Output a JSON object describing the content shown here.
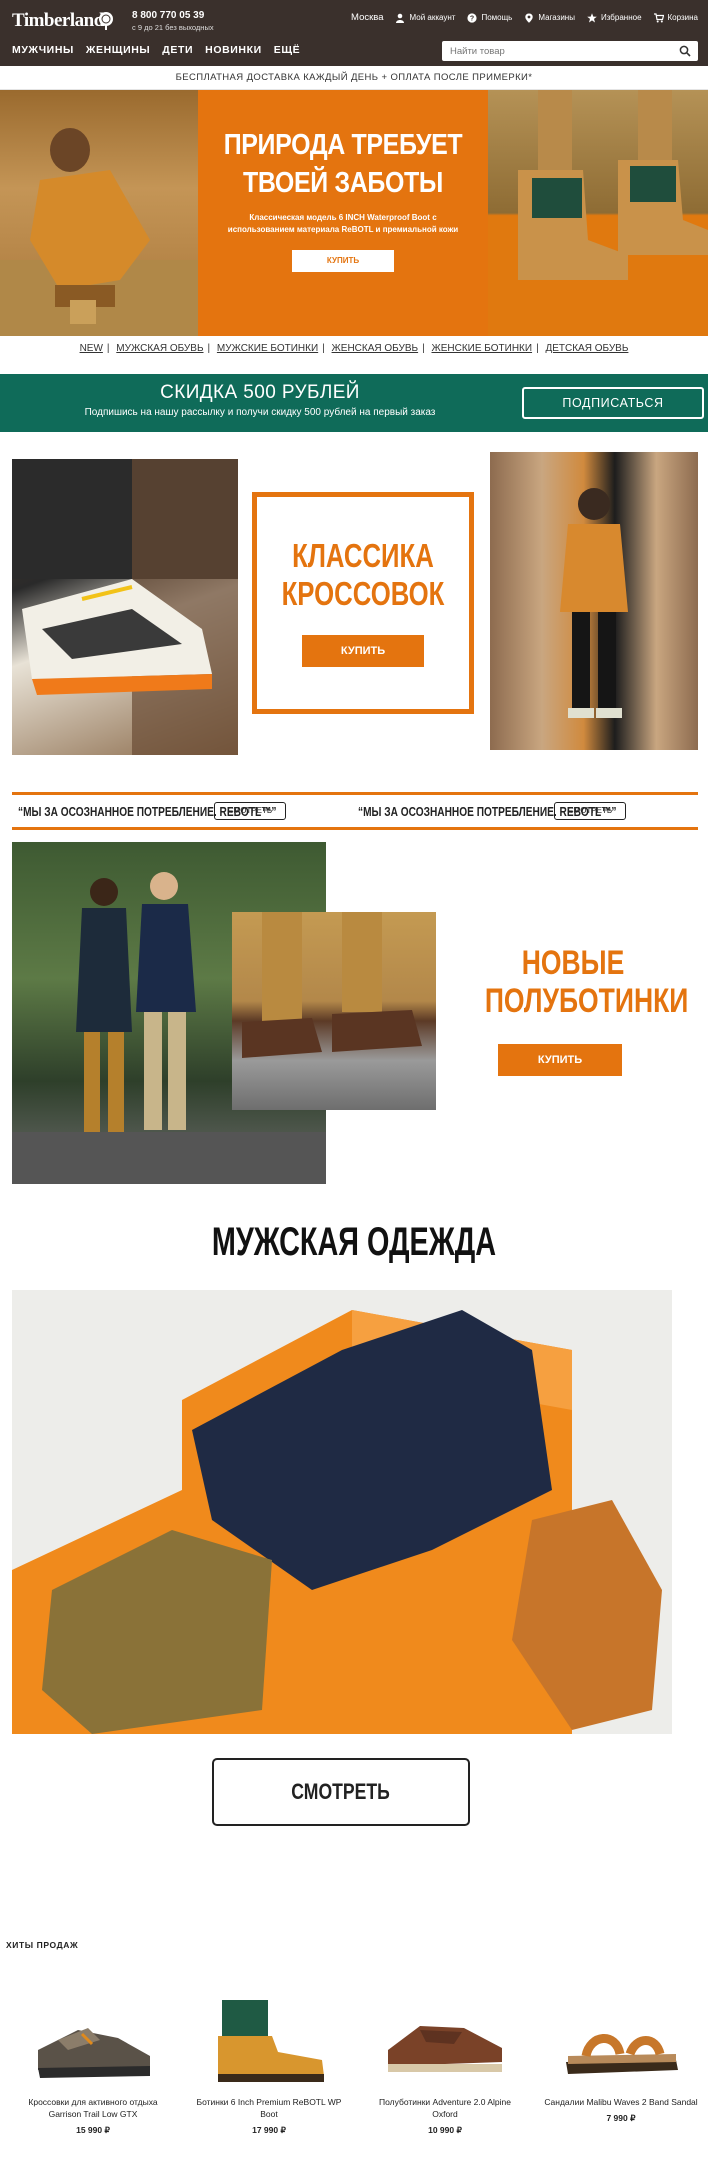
{
  "header": {
    "logo": "Timberland",
    "phone": "8 800 770 05 39",
    "hours": "с 9 до 21 без выходных",
    "city": "Москва",
    "links": [
      "Мой аккаунт",
      "Помощь",
      "Магазины",
      "Избранное",
      "Корзина"
    ],
    "nav": [
      "МУЖЧИНЫ",
      "ЖЕНЩИНЫ",
      "ДЕТИ",
      "НОВИНКИ",
      "ЕЩЁ"
    ],
    "search_placeholder": "Найти товар"
  },
  "promo_strip": "БЕСПЛАТНАЯ ДОСТАВКА КАЖДЫЙ ДЕНЬ + ОПЛАТА ПОСЛЕ ПРИМЕРКИ*",
  "hero": {
    "title_line1": "ПРИРОДА ТРЕБУЕТ",
    "title_line2": "ТВОЕЙ ЗАБОТЫ",
    "subtitle": "Классическая модель 6 INCH Waterproof Boot с использованием материала ReBOTL и премиальной кожи",
    "button": "КУПИТЬ"
  },
  "categories": [
    "NEW",
    "МУЖСКАЯ ОБУВЬ",
    "МУЖСКИЕ БОТИНКИ",
    "ЖЕНСКАЯ ОБУВЬ",
    "ЖЕНСКИЕ БОТИНКИ",
    "ДЕТСКАЯ ОБУВЬ"
  ],
  "subscribe": {
    "title": "СКИДКА 500 РУБЛЕЙ",
    "text": "Подпишись на нашу рассылку и получи скидку 500 рублей на первый заказ",
    "button": "ПОДПИСАТЬСЯ"
  },
  "sneakers": {
    "title_line1": "КЛАССИКА",
    "title_line2": "КРОССОВОК",
    "button": "КУПИТЬ"
  },
  "band": {
    "text": "“МЫ ЗА ОСОЗНАННОЕ ПОТРЕБЛЕНИЕ. REBOTL™”",
    "button": "СМОТРЕТЬ"
  },
  "oxfords": {
    "title_line1": "НОВЫЕ",
    "title_line2": "ПОЛУБОТИНКИ",
    "button": "КУПИТЬ"
  },
  "mens": {
    "title": "МУЖСКАЯ ОДЕЖДА",
    "button": "СМОТРЕТЬ"
  },
  "hits": {
    "title": "ХИТЫ ПРОДАЖ",
    "products": [
      {
        "name": "Кроссовки для активного отдыха Garrison Trail Low GTX",
        "price": "15 990 ₽",
        "icon": "sneaker"
      },
      {
        "name": "Ботинки 6 Inch Premium ReBOTL WP Boot",
        "price": "17 990 ₽",
        "icon": "boot"
      },
      {
        "name": "Полуботинки Adventure 2.0 Alpine Oxford",
        "price": "10 990 ₽",
        "icon": "oxford"
      },
      {
        "name": "Сандалии Malibu Waves 2 Band Sandal",
        "price": "7 990 ₽",
        "icon": "sandal"
      }
    ]
  },
  "colors": {
    "header_bg": "#3a302c",
    "accent_orange": "#e4740f",
    "subscribe_green": "#0f6b59"
  }
}
